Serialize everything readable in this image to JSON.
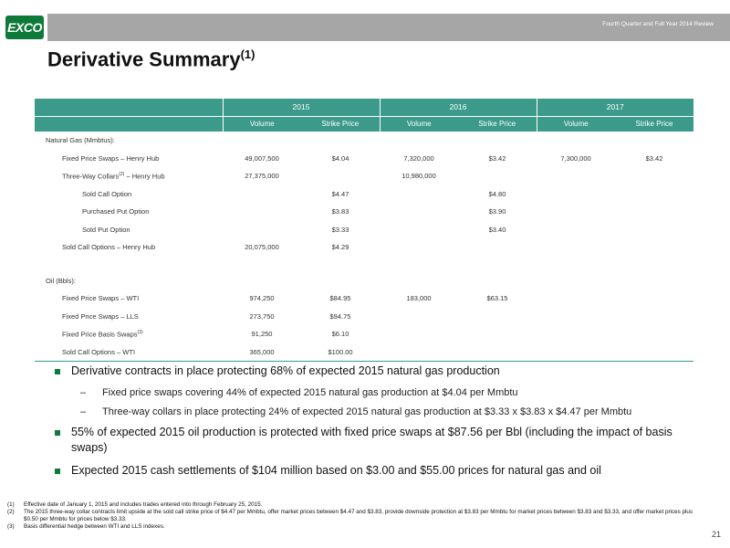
{
  "header": {
    "logo_text": "EXCO",
    "review_label": "Fourth Quarter and Full Year 2014 Review"
  },
  "title": {
    "text": "Derivative Summary",
    "superscript": "(1)"
  },
  "table": {
    "years": [
      "2015",
      "2016",
      "2017"
    ],
    "col_headers": [
      "Volume",
      "Strike Price",
      "Volume",
      "Strike Price",
      "Volume",
      "Strike Price"
    ],
    "rows": [
      {
        "label": "Natural Gas (Mmbtus):",
        "sup": "",
        "level": 0,
        "cells": [
          "",
          "",
          "",
          "",
          "",
          ""
        ]
      },
      {
        "label": "Fixed Price Swaps – Henry Hub",
        "sup": "",
        "level": 1,
        "cells": [
          "49,007,500",
          "$4.04",
          "7,320,000",
          "$3.42",
          "7,300,000",
          "$3.42"
        ]
      },
      {
        "label": "Three-Way Collars",
        "sup": "(2)",
        "suffix": " – Henry Hub",
        "level": 1,
        "cells": [
          "27,375,000",
          "",
          "10,980,000",
          "",
          "",
          ""
        ]
      },
      {
        "label": "Sold Call Option",
        "sup": "",
        "level": 2,
        "cells": [
          "",
          "$4.47",
          "",
          "$4.80",
          "",
          ""
        ]
      },
      {
        "label": "Purchased Put Option",
        "sup": "",
        "level": 2,
        "cells": [
          "",
          "$3.83",
          "",
          "$3.90",
          "",
          ""
        ]
      },
      {
        "label": "Sold Put Option",
        "sup": "",
        "level": 2,
        "cells": [
          "",
          "$3.33",
          "",
          "$3.40",
          "",
          ""
        ]
      },
      {
        "label": "Sold Call Options – Henry Hub",
        "sup": "",
        "level": 1,
        "cells": [
          "20,075,000",
          "$4.29",
          "",
          "",
          "",
          ""
        ]
      },
      {
        "label": "",
        "sup": "",
        "level": 0,
        "spacer": true,
        "cells": [
          "",
          "",
          "",
          "",
          "",
          ""
        ]
      },
      {
        "label": "Oil (Bbls):",
        "sup": "",
        "level": 0,
        "cells": [
          "",
          "",
          "",
          "",
          "",
          ""
        ]
      },
      {
        "label": "Fixed Price Swaps – WTI",
        "sup": "",
        "level": 1,
        "cells": [
          "974,250",
          "$84.95",
          "183,000",
          "$63.15",
          "",
          ""
        ]
      },
      {
        "label": "Fixed Price Swaps – LLS",
        "sup": "",
        "level": 1,
        "cells": [
          "273,750",
          "$94.75",
          "",
          "",
          "",
          ""
        ]
      },
      {
        "label": "Fixed Price Basis Swaps",
        "sup": "(3)",
        "level": 1,
        "cells": [
          "91,250",
          "$6.10",
          "",
          "",
          "",
          ""
        ]
      },
      {
        "label": "Sold Call Options – WTI",
        "sup": "",
        "level": 1,
        "cells": [
          "365,000",
          "$100.00",
          "",
          "",
          "",
          ""
        ]
      }
    ]
  },
  "bullets": [
    {
      "text": "Derivative contracts in place protecting 68% of expected 2015 natural gas production",
      "subs": [
        "Fixed price swaps covering 44% of expected 2015 natural gas production at $4.04 per Mmbtu",
        "Three-way collars in place protecting 24% of expected 2015 natural gas production at $3.33 x $3.83 x $4.47 per Mmbtu"
      ]
    },
    {
      "text": "55% of expected 2015 oil production is protected with fixed price swaps at $87.56 per Bbl (including the impact of basis swaps)",
      "subs": []
    },
    {
      "text": "Expected 2015 cash settlements of $104 million based on $3.00 and $55.00 prices for natural gas and oil",
      "subs": []
    }
  ],
  "sub_dash": "–",
  "footnotes": [
    {
      "mark": "(1)",
      "text": "Effective date of January 1, 2015 and includes trades entered into through February 25, 2015."
    },
    {
      "mark": "(2)",
      "text": "The 2015 three-way collar contracts limit upside at the sold call strike price of $4.47 per Mmbtu, offer market prices between $4.47 and $3.83, provide downside protection at $3.83 per Mmbtu for market prices between $3.83 and $3.33, and offer market prices plus $0.50 per Mmbtu for prices below $3.33."
    },
    {
      "mark": "(3)",
      "text": "Basis differential hedge between WTI and LLS indexes."
    }
  ],
  "page_number": "21",
  "colors": {
    "accent": "#3b9a8a",
    "brand": "#0e7a3a",
    "header_gray": "#a6a6a6"
  }
}
